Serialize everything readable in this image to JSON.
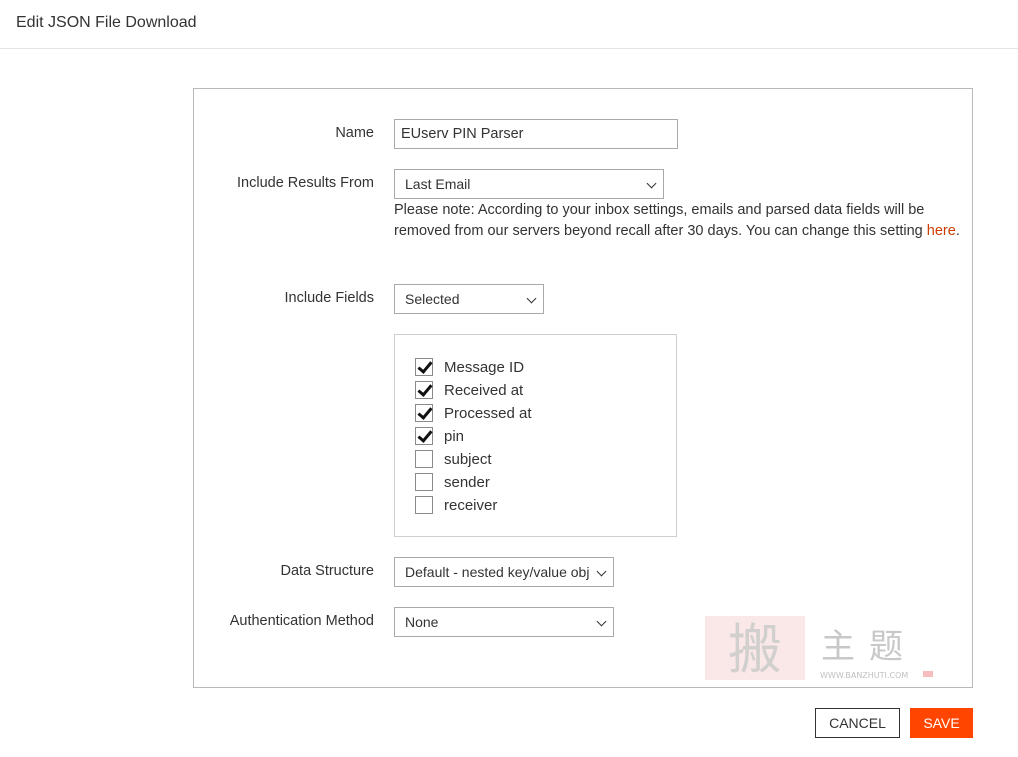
{
  "header": {
    "title": "Edit JSON File Download"
  },
  "form": {
    "name": {
      "label": "Name",
      "value": "EUserv PIN Parser"
    },
    "include_results": {
      "label": "Include Results From",
      "selected": "Last Email",
      "note_text": "Please note: According to your inbox settings, emails and parsed data fields will be removed from our servers beyond recall after 30 days. You can change this setting ",
      "note_link": "here",
      "note_end": "."
    },
    "include_fields": {
      "label": "Include Fields",
      "selected": "Selected",
      "options": [
        {
          "label": "Message ID",
          "checked": true
        },
        {
          "label": "Received at",
          "checked": true
        },
        {
          "label": "Processed at",
          "checked": true
        },
        {
          "label": "pin",
          "checked": true
        },
        {
          "label": "subject",
          "checked": false
        },
        {
          "label": "sender",
          "checked": false
        },
        {
          "label": "receiver",
          "checked": false
        }
      ]
    },
    "data_structure": {
      "label": "Data Structure",
      "selected": "Default - nested key/value objects"
    },
    "auth_method": {
      "label": "Authentication Method",
      "selected": "None"
    }
  },
  "actions": {
    "cancel": "CANCEL",
    "save": "SAVE"
  },
  "watermark": {
    "main": "搬主题",
    "url": "WWW.BANZHUTI.COM"
  },
  "colors": {
    "accent": "#ff4500",
    "link": "#d03b00"
  }
}
